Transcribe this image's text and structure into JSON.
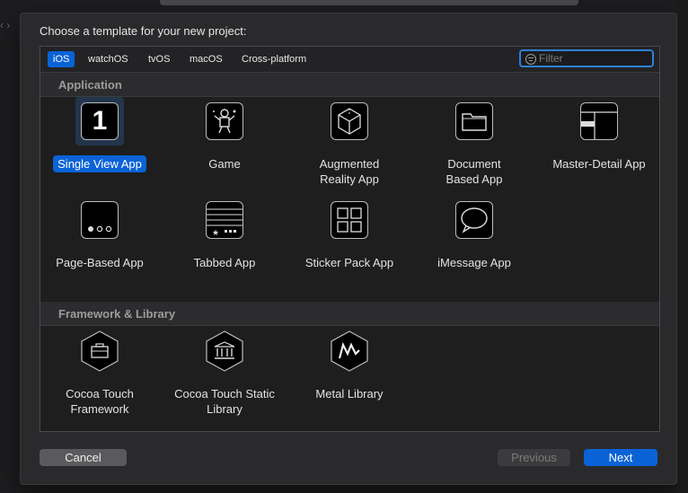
{
  "sheet": {
    "title": "Choose a template for your new project:"
  },
  "tabs": [
    {
      "label": "iOS",
      "active": true
    },
    {
      "label": "watchOS",
      "active": false
    },
    {
      "label": "tvOS",
      "active": false
    },
    {
      "label": "macOS",
      "active": false
    },
    {
      "label": "Cross-platform",
      "active": false
    }
  ],
  "filter": {
    "placeholder": "Filter",
    "value": ""
  },
  "sections": [
    {
      "title": "Application",
      "templates": [
        {
          "label": "Single View App",
          "icon": "single-view-app-icon",
          "selected": true
        },
        {
          "label": "Game",
          "icon": "game-icon",
          "selected": false
        },
        {
          "label": "Augmented Reality App",
          "icon": "augmented-reality-icon",
          "selected": false
        },
        {
          "label": "Document Based App",
          "icon": "document-icon",
          "selected": false
        },
        {
          "label": "Master-Detail App",
          "icon": "master-detail-icon",
          "selected": false
        },
        {
          "label": "Page-Based App",
          "icon": "page-based-icon",
          "selected": false
        },
        {
          "label": "Tabbed App",
          "icon": "tabbed-icon",
          "selected": false
        },
        {
          "label": "Sticker Pack App",
          "icon": "sticker-pack-icon",
          "selected": false
        },
        {
          "label": "iMessage App",
          "icon": "imessage-icon",
          "selected": false
        }
      ]
    },
    {
      "title": "Framework & Library",
      "templates": [
        {
          "label": "Cocoa Touch Framework",
          "icon": "framework-icon",
          "selected": false
        },
        {
          "label": "Cocoa Touch Static Library",
          "icon": "static-library-icon",
          "selected": false
        },
        {
          "label": "Metal Library",
          "icon": "metal-library-icon",
          "selected": false
        }
      ]
    }
  ],
  "single_view_glyph": "1",
  "buttons": {
    "cancel": "Cancel",
    "previous": "Previous",
    "next": "Next"
  },
  "colors": {
    "accent": "#0a63d6",
    "background": "#1e1e1e"
  }
}
